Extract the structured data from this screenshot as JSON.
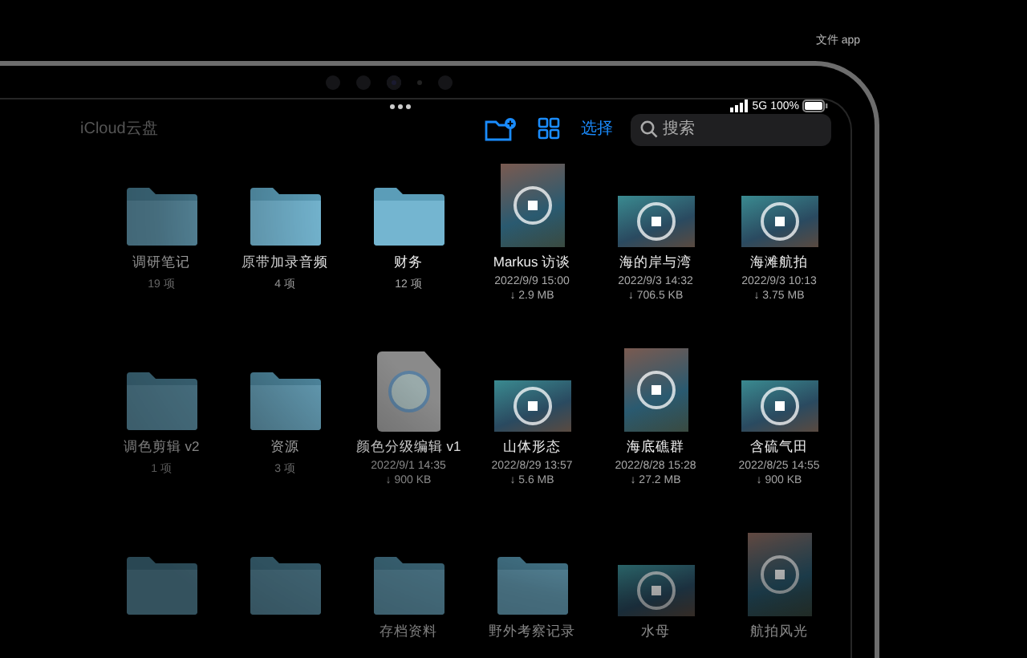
{
  "caption": "文件 app",
  "status_bar": {
    "network": "5G",
    "battery": "100%"
  },
  "toolbar": {
    "title": "iCloud云盘",
    "select": "选择",
    "search": {
      "placeholder": "搜索"
    }
  },
  "items": [
    {
      "kind": "folder",
      "name": "调研笔记",
      "count": "19 项"
    },
    {
      "kind": "folder",
      "name": "原带加录音频",
      "count": "4 项"
    },
    {
      "kind": "folder",
      "name": "财务",
      "count": "12 项"
    },
    {
      "kind": "portrait",
      "name": "Markus 访谈",
      "date": "2022/9/9 15:00",
      "size": "↓ 2.9 MB"
    },
    {
      "kind": "video",
      "name": "海的岸与湾",
      "date": "2022/9/3 14:32",
      "size": "↓ 706.5 KB"
    },
    {
      "kind": "video",
      "name": "海滩航拍",
      "date": "2022/9/3 10:13",
      "size": "↓ 3.75 MB"
    },
    {
      "kind": "folder",
      "name": "调色剪辑 v2",
      "count": "1 项"
    },
    {
      "kind": "folder",
      "name": "资源",
      "count": "3 项"
    },
    {
      "kind": "document",
      "name": "颜色分级编辑 v1",
      "date": "2022/9/1 14:35",
      "size": "↓ 900 KB"
    },
    {
      "kind": "video",
      "name": "山体形态",
      "date": "2022/8/29 13:57",
      "size": "↓ 5.6 MB"
    },
    {
      "kind": "portrait",
      "name": "海底礁群",
      "date": "2022/8/28 15:28",
      "size": "↓ 27.2 MB"
    },
    {
      "kind": "video",
      "name": "含硫气田",
      "date": "2022/8/25 14:55",
      "size": "↓ 900 KB"
    },
    {
      "kind": "folder"
    },
    {
      "kind": "folder"
    },
    {
      "kind": "folder",
      "name": "存档资料"
    },
    {
      "kind": "folder",
      "name": "野外考察记录"
    },
    {
      "kind": "video",
      "name": "水母"
    },
    {
      "kind": "portrait",
      "name": "航拍风光"
    }
  ]
}
